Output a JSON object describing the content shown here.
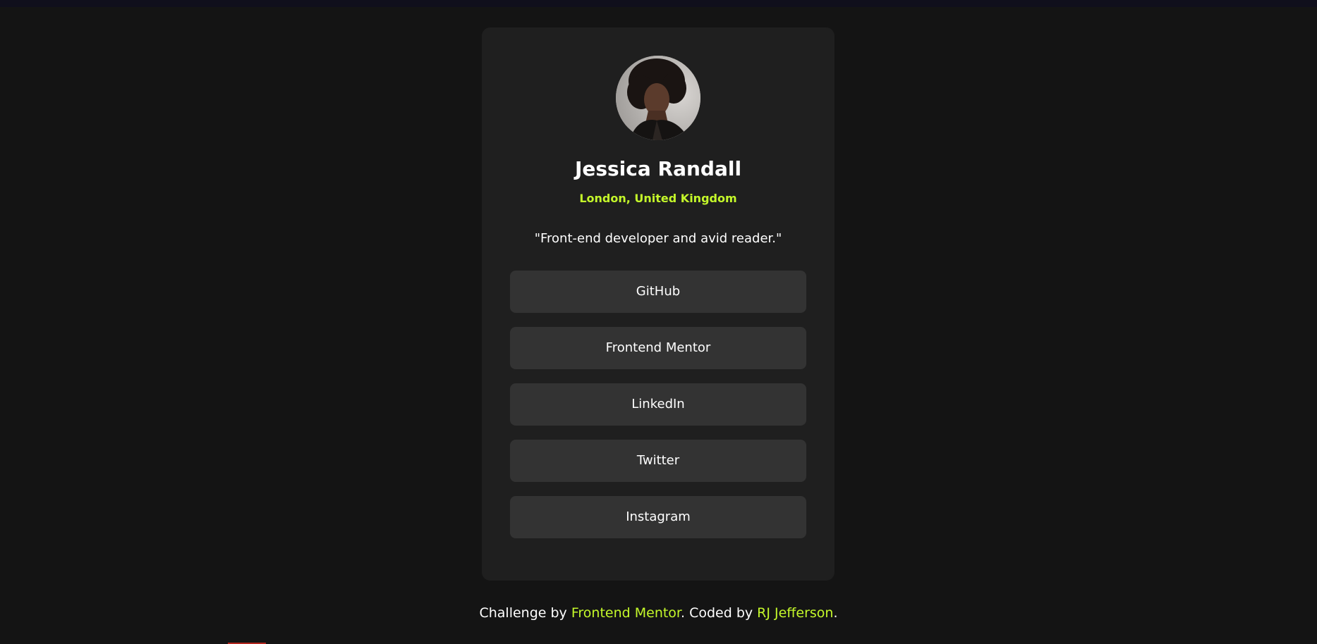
{
  "profile": {
    "name": "Jessica Randall",
    "location": "London, United Kingdom",
    "bio": "\"Front-end developer and avid reader.\"",
    "avatar_icon": "portrait-photo"
  },
  "links": [
    {
      "label": "GitHub"
    },
    {
      "label": "Frontend Mentor"
    },
    {
      "label": "LinkedIn"
    },
    {
      "label": "Twitter"
    },
    {
      "label": "Instagram"
    }
  ],
  "footer": {
    "prefix": "Challenge by ",
    "challenge_link": "Frontend Mentor",
    "middle": ". Coded by ",
    "author_link": "RJ Jefferson",
    "suffix": "."
  },
  "colors": {
    "background": "#141414",
    "card": "#1f1f1f",
    "button": "#333333",
    "accent": "#c4f82a",
    "text": "#ffffff"
  }
}
